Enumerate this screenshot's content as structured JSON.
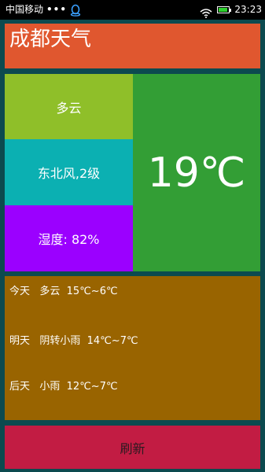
{
  "status_bar": {
    "carrier": "中国移动",
    "dots": "•••",
    "time": "23:23",
    "battery_level": 0.9,
    "icons": [
      "qq-icon",
      "wifi-icon",
      "battery-icon"
    ]
  },
  "title": "成都天气",
  "current": {
    "weather": "多云",
    "wind": "东北风,2级",
    "humidity": "湿度: 82%",
    "temperature": "19℃"
  },
  "forecast": [
    {
      "text": "今天   多云  15℃~6℃"
    },
    {
      "text": "明天   阴转小雨  14℃~7℃"
    },
    {
      "text": "后天   小雨  12℃~7℃"
    }
  ],
  "refresh_label": "刷新",
  "colors": {
    "background": "#0c4a4f",
    "title": "#e0572f",
    "weather": "#8fbf29",
    "wind": "#0bb0b2",
    "humidity": "#9b00ff",
    "temperature": "#339e35",
    "forecast": "#996400",
    "refresh": "#c21c43"
  }
}
